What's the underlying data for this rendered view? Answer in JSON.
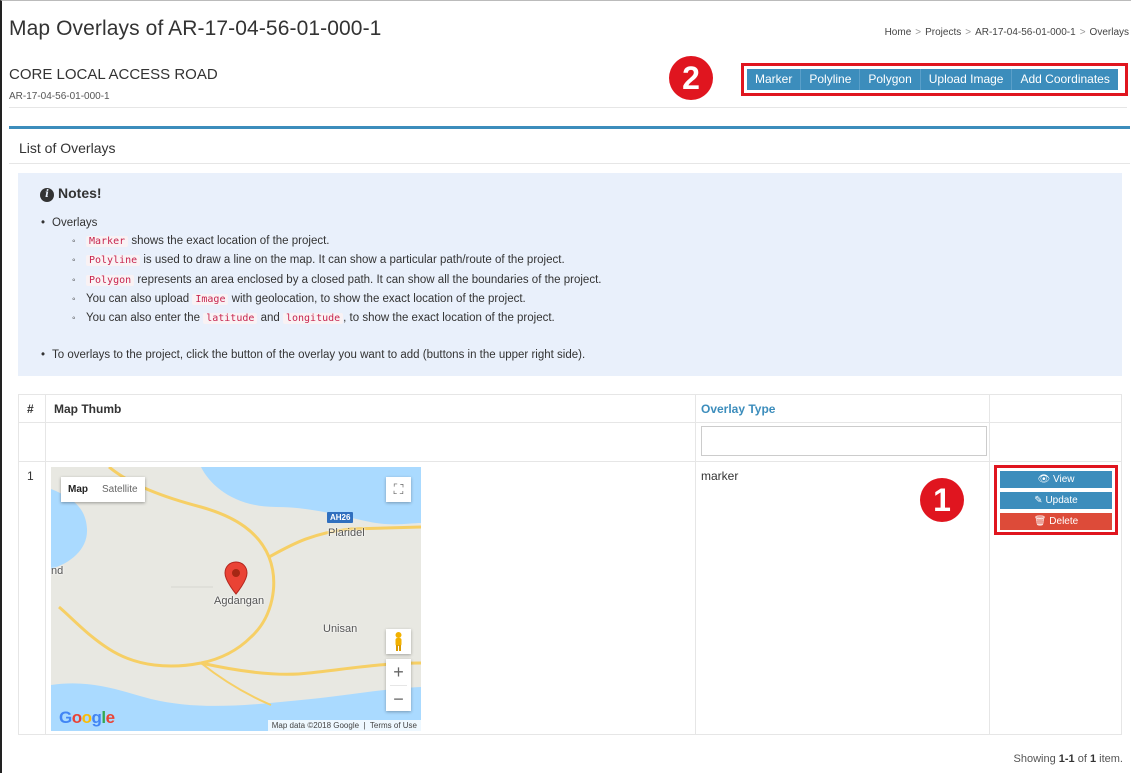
{
  "header": {
    "title": "Map Overlays of AR-17-04-56-01-000-1",
    "breadcrumb": [
      "Home",
      "Projects",
      "AR-17-04-56-01-000-1",
      "Overlays"
    ]
  },
  "project": {
    "name": "CORE LOCAL ACCESS ROAD",
    "code": "AR-17-04-56-01-000-1"
  },
  "toolbar": {
    "buttons": [
      "Marker",
      "Polyline",
      "Polygon",
      "Upload Image",
      "Add Coordinates"
    ]
  },
  "callouts": [
    "1",
    "2"
  ],
  "box": {
    "title": "List of Overlays"
  },
  "notes": {
    "title": "Notes!",
    "overlays_label": "Overlays",
    "items": [
      {
        "code": "Marker",
        "text": " shows the exact location of the project."
      },
      {
        "code": "Polyline",
        "text": " is used to draw a line on the map. It can show a particular path/route of the project."
      },
      {
        "code": "Polygon",
        "text": " represents an area enclosed by a closed path. It can show all the boundaries of the project."
      }
    ],
    "upload_pre": "You can also upload ",
    "upload_code": "Image",
    "upload_post": " with geolocation, to show the exact location of the project.",
    "coords_pre": "You can also enter the ",
    "coords_code1": "latitude",
    "coords_mid": " and ",
    "coords_code2": "longitude",
    "coords_post": ", to show the exact location of the project.",
    "instruction": "To overlays to the project, click the button of the overlay you want to add (buttons in the upper right side)."
  },
  "table": {
    "headers": {
      "num": "#",
      "thumb": "Map Thumb",
      "type": "Overlay Type"
    },
    "filter_value": "",
    "rows": [
      {
        "num": "1",
        "type": "marker",
        "actions": {
          "view": "View",
          "update": "Update",
          "delete": "Delete"
        }
      }
    ]
  },
  "map": {
    "type_buttons": [
      "Map",
      "Satellite"
    ],
    "labels": {
      "plaridel": "Plaridel",
      "agdangan": "Agdangan",
      "unisan": "Unisan",
      "edge": "nd"
    },
    "shield": "AH26",
    "logo": "Google",
    "attribution": "Map data ©2018 Google",
    "terms": "Terms of Use",
    "colors": {
      "water": "#aadaff",
      "land": "#e8e8e2",
      "road": "#f6cf65",
      "pin": "#ea4335"
    }
  },
  "summary": {
    "pre": "Showing ",
    "range": "1-1",
    "mid": " of ",
    "total": "1",
    "post": " item."
  }
}
